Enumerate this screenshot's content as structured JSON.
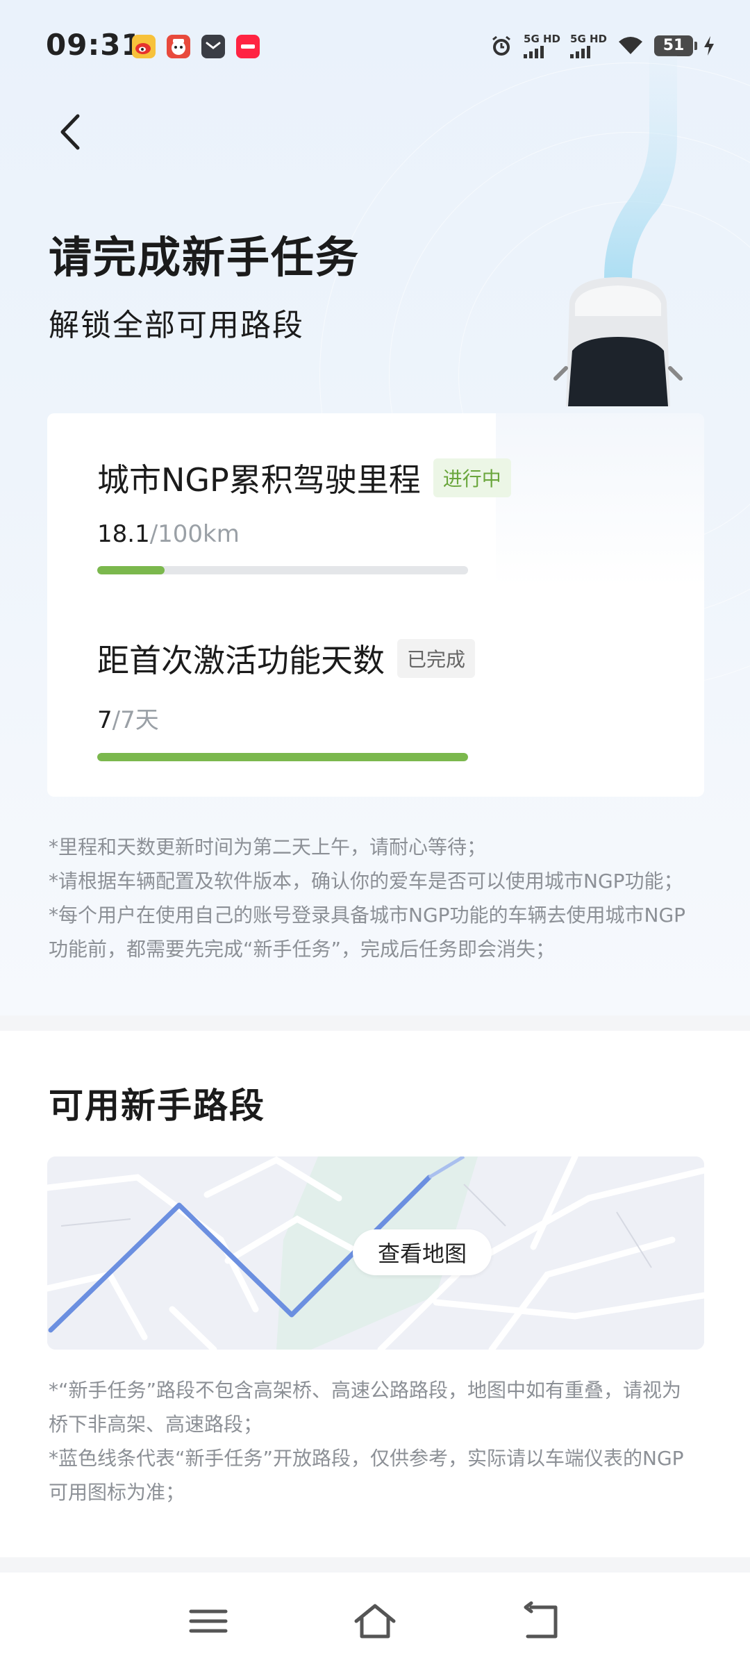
{
  "status_bar": {
    "time": "09:31",
    "network_1": "5G HD",
    "network_2": "5G HD",
    "battery": "51"
  },
  "header": {
    "title": "请完成新手任务",
    "subtitle": "解锁全部可用路段"
  },
  "tasks": [
    {
      "title": "城市NGP累积驾驶里程",
      "badge": "进行中",
      "current": "18.1",
      "total": "/100km",
      "progress": 0.181
    },
    {
      "title": "距首次激活功能天数",
      "badge": "已完成",
      "current": "7",
      "total": "/7天",
      "progress": 1.0
    }
  ],
  "notes_1": [
    "*里程和天数更新时间为第二天上午，请耐心等待；",
    "*请根据车辆配置及软件版本，确认你的爱车是否可以使用城市NGP功能；",
    "*每个用户在使用自己的账号登录具备城市NGP功能的车辆去使用城市NGP",
    "功能前，都需要先完成“新手任务”，完成后任务即会消失；"
  ],
  "routes": {
    "title": "可用新手路段",
    "map_button": "查看地图"
  },
  "notes_2": [
    "*“新手任务”路段不包含高架桥、高速公路路段，地图中如有重叠，请视为",
    "桥下非高架、高速路段；",
    "*蓝色线条代表“新手任务”开放路段，仅供参考，实际请以车端仪表的NGP",
    "可用图标为准；"
  ],
  "colors": {
    "progress_green": "#7bb84d",
    "route_blue": "#6b8fe0",
    "badge_progress_text": "#6aa63c"
  },
  "nav": [
    "menu-icon",
    "home-icon",
    "back-icon"
  ]
}
